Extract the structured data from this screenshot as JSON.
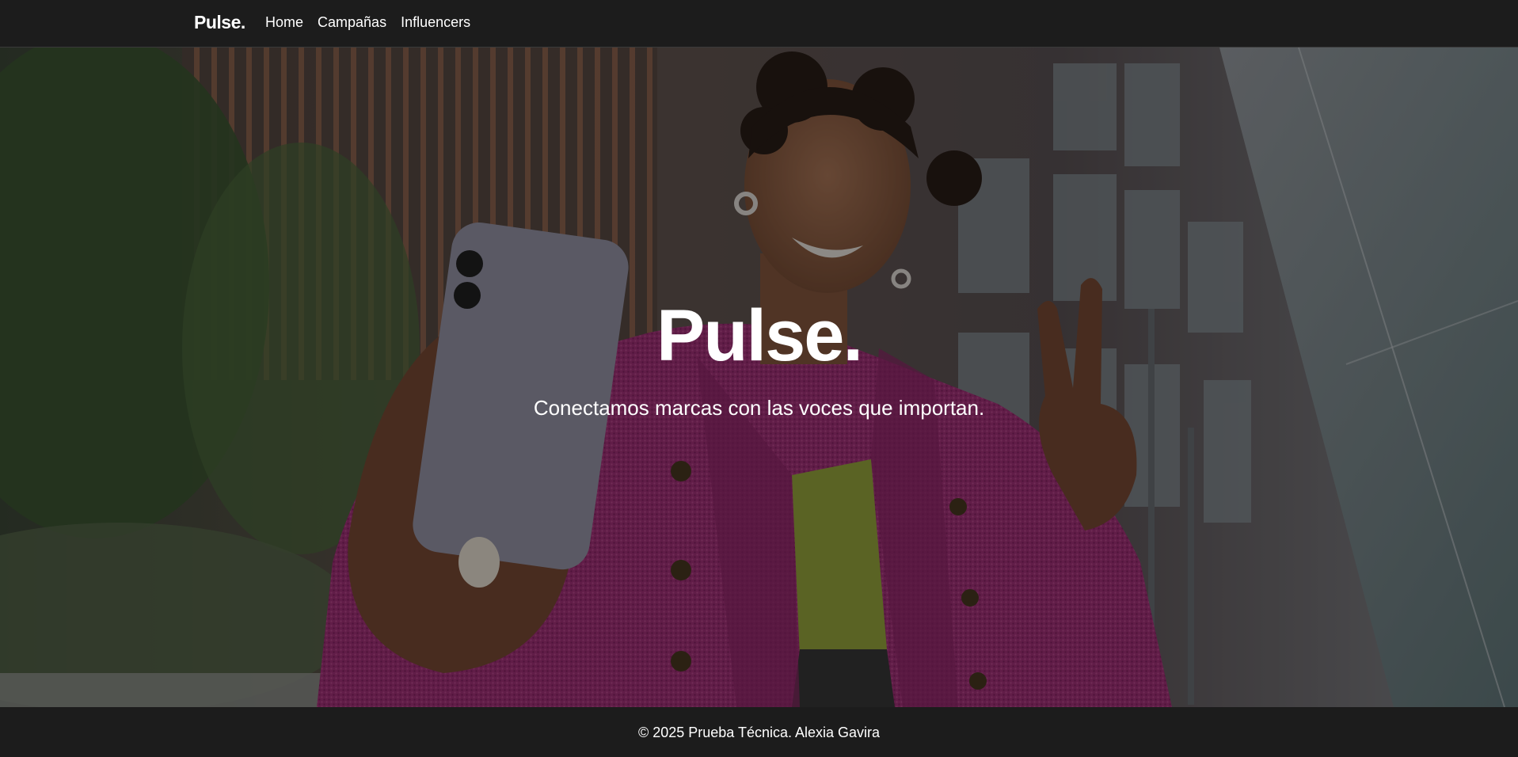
{
  "navbar": {
    "brand": "Pulse.",
    "links": [
      {
        "label": "Home"
      },
      {
        "label": "Campañas"
      },
      {
        "label": "Influencers"
      }
    ]
  },
  "hero": {
    "title": "Pulse.",
    "subtitle": "Conectamos marcas con las voces que importan.",
    "background_image": "woman-selfie-photo"
  },
  "footer": {
    "text": "© 2025 Prueba Técnica. Alexia Gavira"
  },
  "colors": {
    "navbar_bg": "#1c1c1c",
    "footer_bg": "#1c1c1c",
    "text": "#ffffff",
    "overlay": "rgba(0,0,0,0.42)"
  }
}
